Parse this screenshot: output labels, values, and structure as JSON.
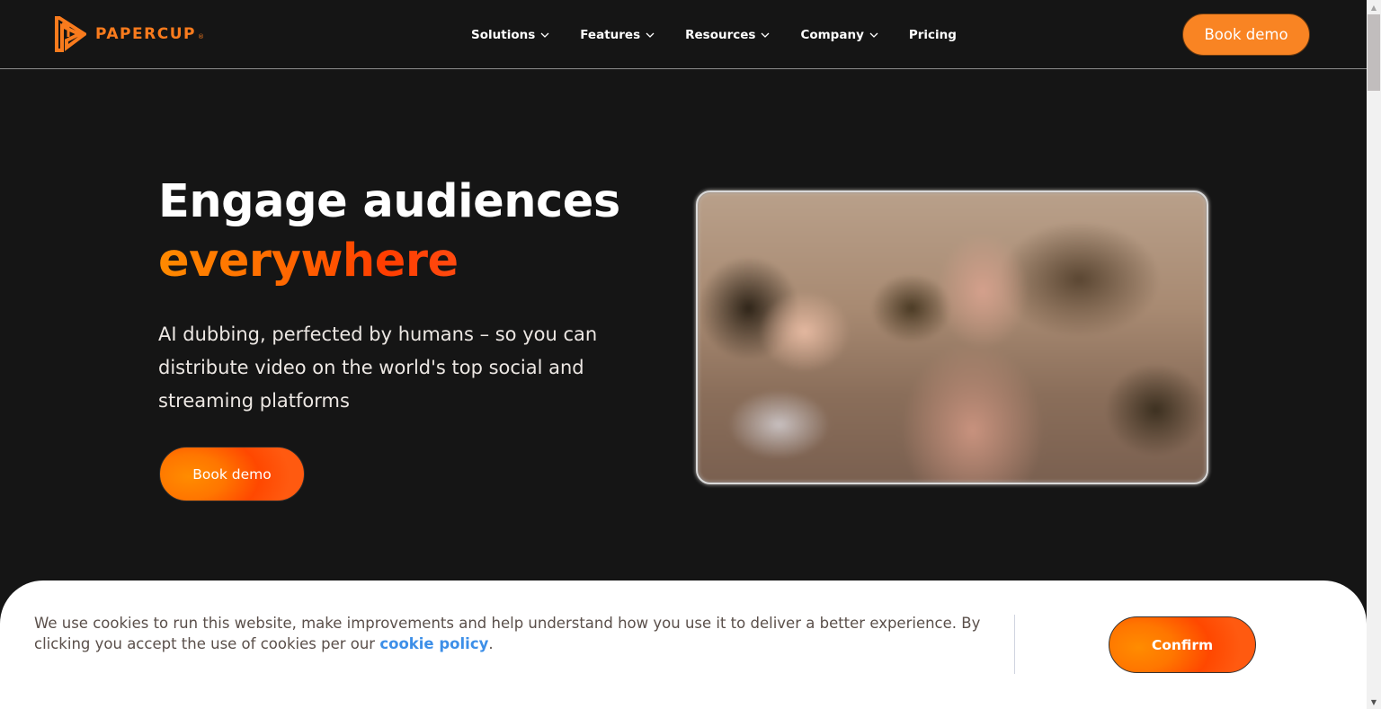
{
  "brand": {
    "name": "PAPERCUP",
    "registered_mark": "®",
    "accent_color": "#f97b1d",
    "icon": "papercup-logo-icon"
  },
  "nav": {
    "items": [
      {
        "label": "Solutions",
        "has_dropdown": true
      },
      {
        "label": "Features",
        "has_dropdown": true
      },
      {
        "label": "Resources",
        "has_dropdown": true
      },
      {
        "label": "Company",
        "has_dropdown": true
      },
      {
        "label": "Pricing",
        "has_dropdown": false
      }
    ],
    "cta_label": "Book demo"
  },
  "hero": {
    "title_line1": "Engage audiences",
    "title_line2": "everywhere",
    "subtitle": "AI dubbing, perfected by humans – so you can distribute video on the world's top social and streaming platforms",
    "cta_label": "Book demo",
    "media": "blurred-video-preview"
  },
  "cookie_banner": {
    "text_before_link": "We use cookies to run this website, make improvements and help understand how you use it to deliver a better experience. By clicking you accept the use of cookies per our ",
    "link_label": "cookie policy",
    "text_after_link": ".",
    "confirm_label": "Confirm",
    "link_color": "#3d8fe8"
  },
  "scrollbar": {
    "up_icon": "▲",
    "down_icon": "▼"
  }
}
